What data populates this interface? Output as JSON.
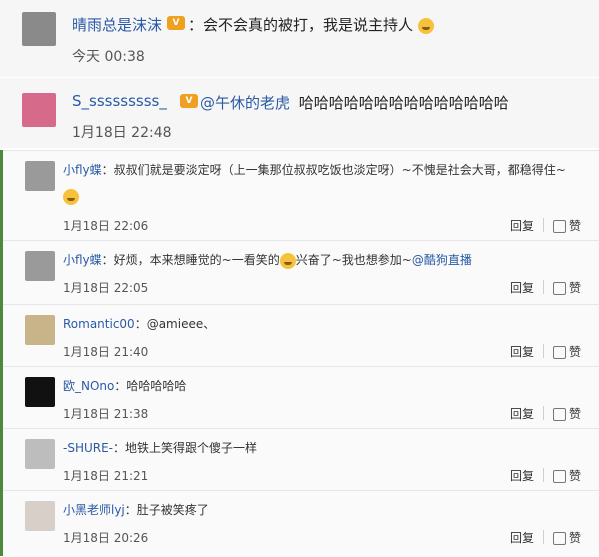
{
  "top_comments": [
    {
      "name": "晴雨总是沫沫",
      "badge": "V",
      "text": "：会不会真的被打，我是说主持人",
      "time": "今天 00:38",
      "avatar_color": "#8a8a8a"
    },
    {
      "name": "S_sssssssss_",
      "badge": "V",
      "mention": "@午休的老虎",
      "text": "哈哈哈哈哈哈哈哈哈哈哈哈哈哈",
      "time": "1月18日 22:48",
      "avatar_color": "#d66a8a"
    }
  ],
  "sub_comments": [
    {
      "name": "小fly蝶",
      "text": "：叔叔们就是要淡定呀（上一集那位叔叔吃饭也淡定呀）~不愧是社会大哥，都稳得住~",
      "time": "1月18日 22:06",
      "reply": "回复",
      "like": "赞",
      "avatar_color": "#9a9a9a"
    },
    {
      "name": "小fly蝶",
      "text": "：好烦，本来想睡觉的~一看笑的",
      "text2": "兴奋了~我也想参加~",
      "mention": "@酷狗直播",
      "time": "1月18日 22:05",
      "reply": "回复",
      "like": "赞",
      "avatar_color": "#9a9a9a"
    },
    {
      "name": "Romantic00",
      "text": "：@amieee、",
      "time": "1月18日 21:40",
      "reply": "回复",
      "like": "赞",
      "avatar_color": "#c9b48a"
    },
    {
      "name": "欧_NOno",
      "text": "：哈哈哈哈哈",
      "time": "1月18日 21:38",
      "reply": "回复",
      "like": "赞",
      "avatar_color": "#111111"
    },
    {
      "name": "-SHURE-",
      "text": "：地铁上笑得跟个傻子一样",
      "time": "1月18日 21:21",
      "reply": "回复",
      "like": "赞",
      "avatar_color": "#bdbdbd"
    },
    {
      "name": "小黑老师lyj",
      "text": "：肚子被笑疼了",
      "time": "1月18日 20:26",
      "reply": "回复",
      "like": "赞",
      "avatar_color": "#d8d0c8"
    }
  ]
}
